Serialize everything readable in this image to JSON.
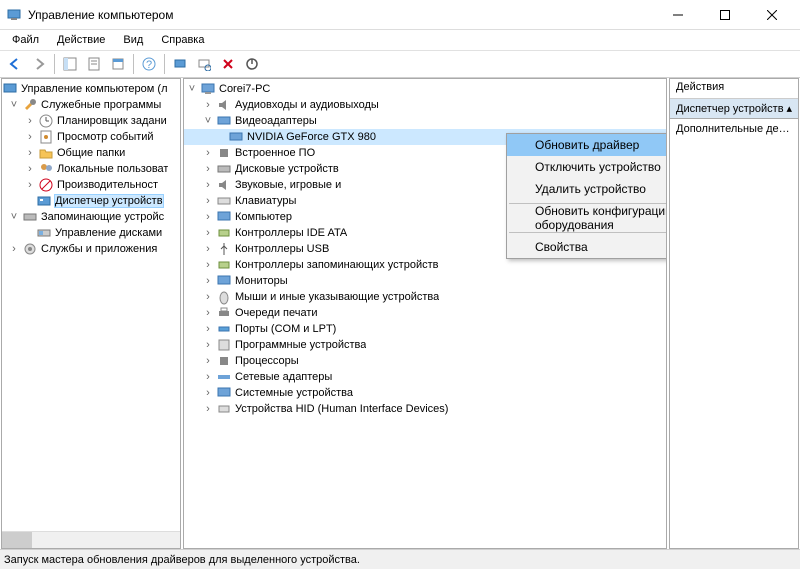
{
  "window": {
    "title": "Управление компьютером"
  },
  "menu": {
    "file": "Файл",
    "action": "Действие",
    "view": "Вид",
    "help": "Справка"
  },
  "left_tree": {
    "root": "Управление компьютером (л",
    "tools": "Служебные программы",
    "tools_items": {
      "scheduler": "Планировщик задани",
      "eventviewer": "Просмотр событий",
      "shared": "Общие папки",
      "users": "Локальные пользоват",
      "perf": "Производительност",
      "devmgr": "Диспетчер устройств"
    },
    "storage": "Запоминающие устройс",
    "storage_items": {
      "disks": "Управление дисками"
    },
    "services": "Службы и приложения"
  },
  "device_tree": {
    "root": "Corei7-PC",
    "audio": "Аудиовходы и аудиовыходы",
    "video": "Видеоадаптеры",
    "video_items": {
      "gpu": "NVIDIA GeForce GTX 980"
    },
    "firmware": "Встроенное ПО",
    "disk": "Дисковые устройств",
    "sound": "Звуковые, игровые и",
    "keyboard": "Клавиатуры",
    "computer": "Компьютер",
    "ide": "Контроллеры IDE ATA",
    "usb": "Контроллеры USB",
    "storagectl": "Контроллеры запоминающих устройств",
    "monitor": "Мониторы",
    "mouse": "Мыши и иные указывающие устройства",
    "print": "Очереди печати",
    "ports": "Порты (COM и LPT)",
    "software": "Программные устройства",
    "cpu": "Процессоры",
    "net": "Сетевые адаптеры",
    "system": "Системные устройства",
    "hid": "Устройства HID (Human Interface Devices)"
  },
  "ctx": {
    "update": "Обновить драйвер",
    "disable": "Отключить устройство",
    "uninstall": "Удалить устройство",
    "scan": "Обновить конфигурацию оборудования",
    "props": "Свойства"
  },
  "actions": {
    "header": "Действия",
    "selected": "Диспетчер устройств",
    "more": "Дополнительные дей..."
  },
  "status": "Запуск мастера обновления драйверов для выделенного устройства."
}
